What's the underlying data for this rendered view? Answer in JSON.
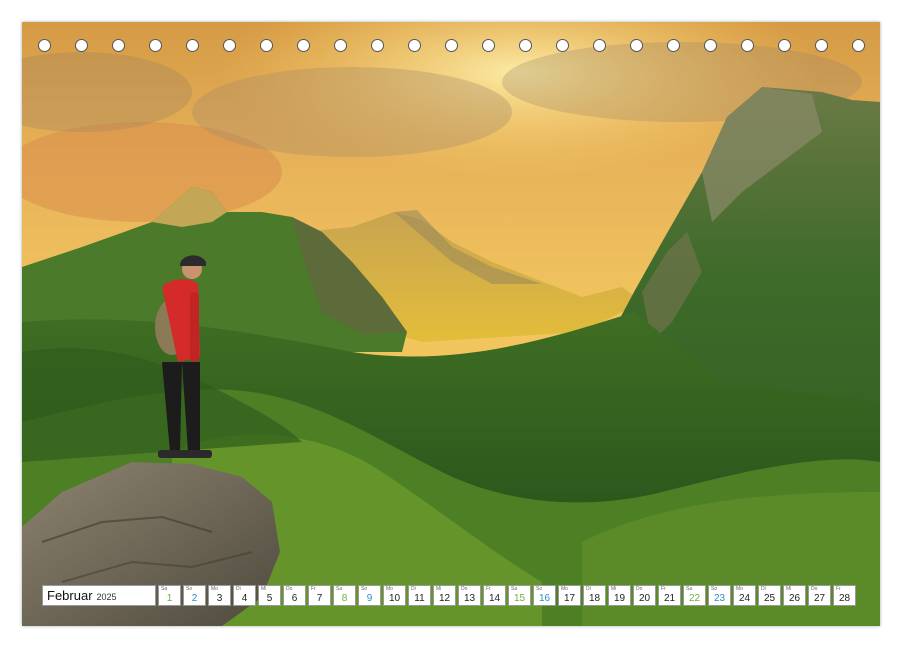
{
  "calendar": {
    "month": "Februar",
    "year": "2025",
    "colors": {
      "saturday": "#6fae3f",
      "sunday": "#2a8fc9"
    },
    "days": [
      {
        "n": "1",
        "wd": "Sa",
        "type": "sat"
      },
      {
        "n": "2",
        "wd": "So",
        "type": "sun"
      },
      {
        "n": "3",
        "wd": "Mo",
        "type": "wk"
      },
      {
        "n": "4",
        "wd": "Di",
        "type": "wk"
      },
      {
        "n": "5",
        "wd": "Mi",
        "type": "wk"
      },
      {
        "n": "6",
        "wd": "Do",
        "type": "wk"
      },
      {
        "n": "7",
        "wd": "Fr",
        "type": "wk"
      },
      {
        "n": "8",
        "wd": "Sa",
        "type": "sat"
      },
      {
        "n": "9",
        "wd": "So",
        "type": "sun"
      },
      {
        "n": "10",
        "wd": "Mo",
        "type": "wk"
      },
      {
        "n": "11",
        "wd": "Di",
        "type": "wk"
      },
      {
        "n": "12",
        "wd": "Mi",
        "type": "wk"
      },
      {
        "n": "13",
        "wd": "Do",
        "type": "wk"
      },
      {
        "n": "14",
        "wd": "Fr",
        "type": "wk"
      },
      {
        "n": "15",
        "wd": "Sa",
        "type": "sat"
      },
      {
        "n": "16",
        "wd": "So",
        "type": "sun"
      },
      {
        "n": "17",
        "wd": "Mo",
        "type": "wk"
      },
      {
        "n": "18",
        "wd": "Di",
        "type": "wk"
      },
      {
        "n": "19",
        "wd": "Mi",
        "type": "wk"
      },
      {
        "n": "20",
        "wd": "Do",
        "type": "wk"
      },
      {
        "n": "21",
        "wd": "Fr",
        "type": "wk"
      },
      {
        "n": "22",
        "wd": "Sa",
        "type": "sat"
      },
      {
        "n": "23",
        "wd": "So",
        "type": "sun"
      },
      {
        "n": "24",
        "wd": "Mo",
        "type": "wk"
      },
      {
        "n": "25",
        "wd": "Di",
        "type": "wk"
      },
      {
        "n": "26",
        "wd": "Mi",
        "type": "wk"
      },
      {
        "n": "27",
        "wd": "Do",
        "type": "wk"
      },
      {
        "n": "28",
        "wd": "Fr",
        "type": "wk"
      }
    ]
  },
  "photo": {
    "subject": "hiker-on-rock-overlooking-mountain-valley"
  },
  "binding": {
    "hole_count": 23
  }
}
